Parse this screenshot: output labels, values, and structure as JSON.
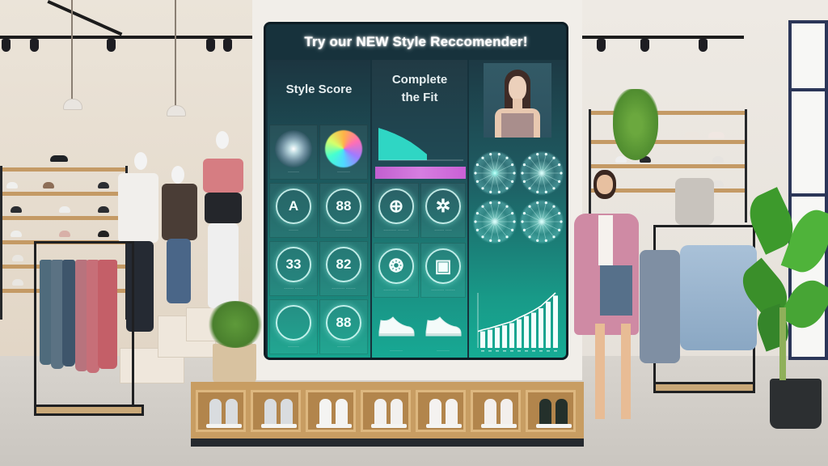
{
  "scene": "Retail clothing store with a large interactive digital display",
  "display": {
    "title": "Try our NEW Style Reccomender!",
    "columns": [
      {
        "heading": "Style Score",
        "tiles": [
          {
            "icon": "particle-orb-icon",
            "label": "·······",
            "badge": ""
          },
          {
            "icon": "color-wheel-icon",
            "label": "········",
            "badge": ""
          },
          {
            "icon": "letter-grade-icon",
            "label": "······",
            "badge": "A"
          },
          {
            "icon": "score-ring-icon",
            "label": "··········",
            "badge": "88"
          },
          {
            "icon": "score-card-icon",
            "label": "······ ·····",
            "badge": "33"
          },
          {
            "icon": "score-ring-icon",
            "label": "········ ······",
            "badge": "82"
          },
          {
            "icon": "message-icon",
            "label": "·······",
            "badge": ""
          },
          {
            "icon": "digital-score-icon",
            "label": "········",
            "badge": "88"
          }
        ]
      },
      {
        "heading": "Complete the Fit",
        "tiles": [
          {
            "icon": "target-icon",
            "label": "········ ·······",
            "badge": ""
          },
          {
            "icon": "sparkle-icon",
            "label": "······ ····",
            "badge": ""
          },
          {
            "icon": "donut-pattern-icon",
            "label": "········ ·······",
            "badge": ""
          },
          {
            "icon": "framed-item-icon",
            "label": "········ ······",
            "badge": ""
          },
          {
            "icon": "sneaker-icon",
            "label": "········",
            "badge": ""
          },
          {
            "icon": "sneaker-icon",
            "label": "········",
            "badge": ""
          }
        ]
      },
      {
        "heading": "",
        "photo_alt": "Model wearing a mauve strapless top",
        "visuals": [
          "network-burst-icon",
          "network-burst-icon",
          "network-burst-icon",
          "network-burst-icon"
        ]
      }
    ],
    "area_chart": {
      "values": [
        1.0,
        0.92,
        0.82,
        0.7,
        0.56,
        0.38,
        0.18
      ]
    },
    "progress_bar_color": "#c960d6",
    "bar_chart": {
      "values": [
        0.3,
        0.33,
        0.37,
        0.41,
        0.45,
        0.52,
        0.58,
        0.64,
        0.72,
        0.84,
        0.95
      ],
      "trend": [
        0.33,
        0.36,
        0.4,
        0.44,
        0.48,
        0.55,
        0.61,
        0.68,
        0.76,
        0.88,
        1.0
      ]
    },
    "accent_colors": {
      "teal": "#17a994",
      "dark": "#17323c",
      "glow": "#bffff3"
    }
  },
  "bench": {
    "cubbies": [
      {
        "shoe_color": "#d9dcdf"
      },
      {
        "shoe_color": "#d9dcdf"
      },
      {
        "shoe_color": "#f4f4f2"
      },
      {
        "shoe_color": "#f2f0ee"
      },
      {
        "shoe_color": "#f4f2f0"
      },
      {
        "shoe_color": "#f3efec"
      },
      {
        "shoe_color": "#24302b"
      }
    ]
  }
}
